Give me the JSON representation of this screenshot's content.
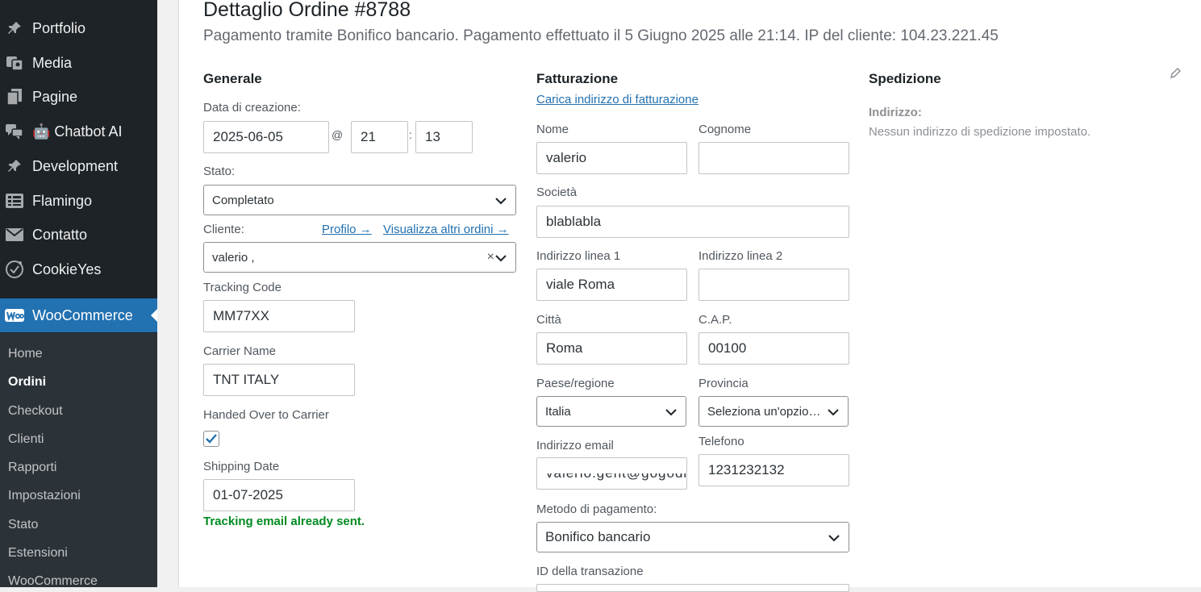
{
  "sidebar": {
    "items": [
      {
        "label": "Portfolio",
        "icon": "pin-icon"
      },
      {
        "label": "Media",
        "icon": "media-icon"
      },
      {
        "label": "Pagine",
        "icon": "pages-icon"
      },
      {
        "label": "🤖 Chatbot AI",
        "icon": "chat-icon"
      },
      {
        "label": "Development",
        "icon": "pin-icon"
      },
      {
        "label": "Flamingo",
        "icon": "flamingo-icon"
      },
      {
        "label": "Contatto",
        "icon": "mail-icon"
      },
      {
        "label": "CookieYes",
        "icon": "cookie-icon"
      }
    ],
    "active": {
      "label": "WooCommerce",
      "icon": "woocommerce-icon"
    },
    "submenu": [
      "Home",
      "Ordini",
      "Checkout",
      "Clienti",
      "Rapporti",
      "Impostazioni",
      "Stato",
      "Estensioni",
      "WooCommerce"
    ],
    "submenu_active": "Ordini"
  },
  "order": {
    "title": "Dettaglio Ordine #8788",
    "subtitle": "Pagamento tramite Bonifico bancario. Pagamento effettuato il 5 Giugno 2025 alle 21:14. IP del cliente: 104.23.221.45"
  },
  "general": {
    "heading": "Generale",
    "created_label": "Data di creazione:",
    "date": "2025-06-05",
    "at": "@",
    "hour": "21",
    "colon": ":",
    "minute": "13",
    "status_label": "Stato:",
    "status": "Completato",
    "customer_label": "Cliente:",
    "profile_link": "Profilo →",
    "other_orders_link": "Visualizza altri ordini →",
    "customer": "valerio  ,",
    "clear_glyph": "×",
    "tracking_label": "Tracking Code",
    "tracking": "MM77XX",
    "carrier_label": "Carrier Name",
    "carrier": "TNT ITALY",
    "handed_label": "Handed Over to Carrier",
    "handed_checked": true,
    "shipping_label": "Shipping Date",
    "shipping_date": "01-07-2025",
    "notice": "Tracking email already sent."
  },
  "billing": {
    "heading": "Fatturazione",
    "load_link": "Carica indirizzo di fatturazione",
    "first_name_label": "Nome",
    "first_name": "valerio",
    "last_name_label": "Cognome",
    "last_name": "",
    "company_label": "Società",
    "company": "blablabla",
    "address1_label": "Indirizzo linea 1",
    "address1": "viale Roma",
    "address2_label": "Indirizzo linea 2",
    "address2": "",
    "city_label": "Città",
    "city": "Roma",
    "postcode_label": "C.A.P.",
    "postcode": "00100",
    "country_label": "Paese/regione",
    "country": "Italia",
    "state_label": "Provincia",
    "state": "Seleziona un'opzio…",
    "email_label": "Indirizzo email",
    "email": "valerio.gent@gogodi",
    "phone_label": "Telefono",
    "phone": "1231232132",
    "payment_label": "Metodo di pagamento:",
    "payment": "Bonifico bancario",
    "transaction_label": "ID della transazione"
  },
  "shipping": {
    "heading": "Spedizione",
    "address_label": "Indirizzo:",
    "address_none": "Nessun indirizzo di spedizione impostato."
  },
  "colors": {
    "sidebar": "#1d2327",
    "accent": "#2271b1",
    "success": "#008a20"
  }
}
